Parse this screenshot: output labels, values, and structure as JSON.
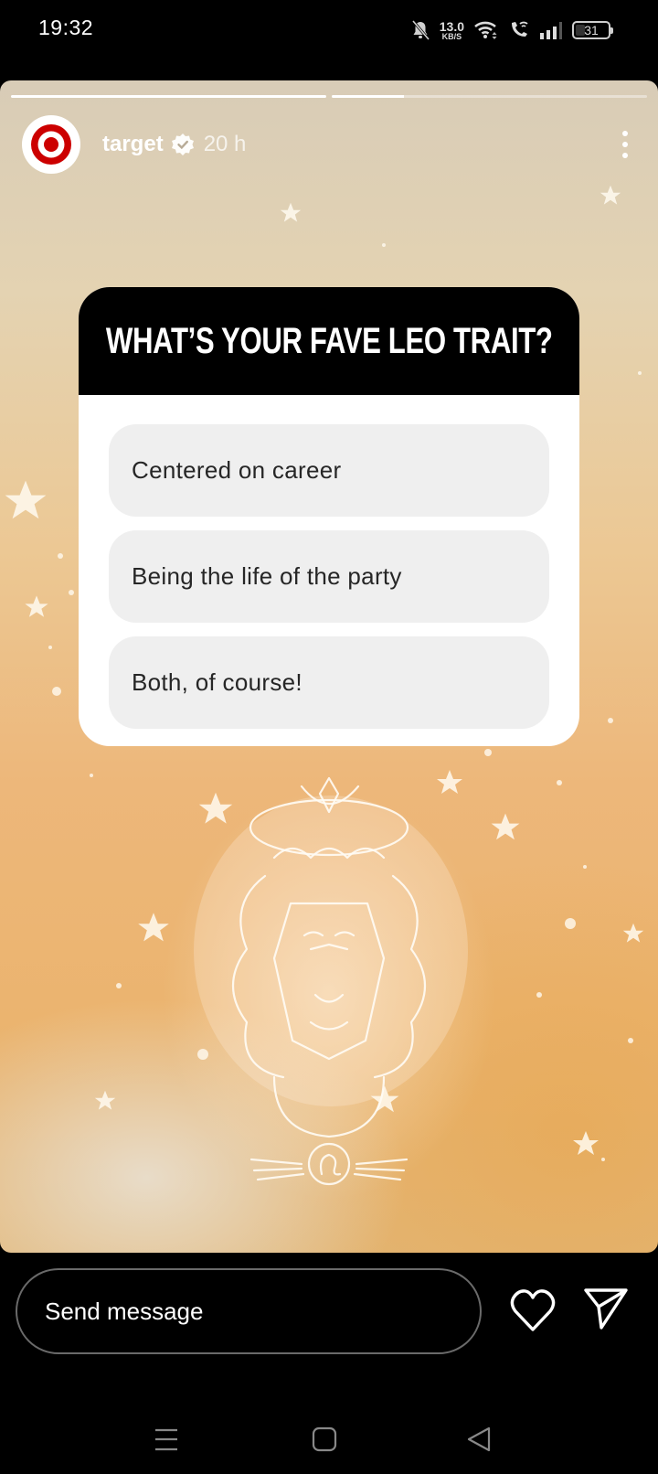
{
  "status_bar": {
    "time": "19:32",
    "icons": [
      "mute-icon",
      "wifi-icon",
      "wifi-calling-icon",
      "signal-icon",
      "battery-icon"
    ],
    "net_speed_value": "13.0",
    "net_speed_unit": "KB/S",
    "battery_level": "31",
    "battery_percent": 31
  },
  "story": {
    "segments": [
      {
        "progress": 1.0
      },
      {
        "progress": 0.23
      }
    ],
    "account": {
      "username": "target",
      "verified": true,
      "time_ago": "20 h",
      "avatar_icon": "target-logo-icon"
    },
    "more_icon": "more-vertical-icon",
    "poll": {
      "question": "WHAT’S YOUR FAVE LEO TRAIT?",
      "options": [
        "Centered on career",
        "Being the life of the party",
        "Both, of course!"
      ]
    },
    "artwork": "leo-lion-constellation-illustration"
  },
  "reply_bar": {
    "placeholder": "Send message",
    "like_icon": "heart-icon",
    "share_icon": "send-icon"
  },
  "nav_bar": {
    "buttons": [
      "recents-icon",
      "home-icon",
      "back-icon"
    ]
  },
  "colors": {
    "brand_red": "#cc0000",
    "poll_header_bg": "#000000",
    "option_bg": "#efefef"
  }
}
